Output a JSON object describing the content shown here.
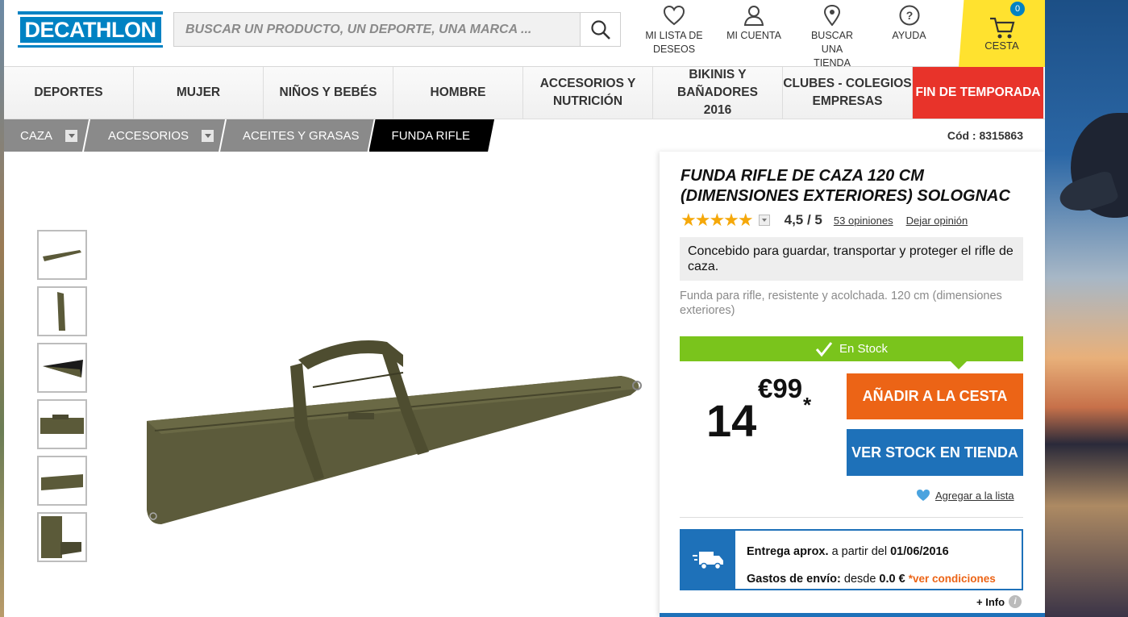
{
  "header": {
    "logo_text": "DECATHLON",
    "search_placeholder": "BUSCAR UN PRODUCTO, UN DEPORTE, UNA MARCA ...",
    "nav": [
      {
        "label_line1": "MI LISTA DE",
        "label_line2": "DESEOS",
        "icon": "heart-icon"
      },
      {
        "label_line1": "MI CUENTA",
        "label_line2": "",
        "icon": "user-icon"
      },
      {
        "label_line1": "BUSCAR UNA",
        "label_line2": "TIENDA",
        "icon": "map-pin-icon"
      },
      {
        "label_line1": "AYUDA",
        "label_line2": "",
        "icon": "help-icon"
      }
    ],
    "cart_label": "CESTA",
    "cart_count": "0"
  },
  "main_nav": [
    {
      "line1": "DEPORTES",
      "line2": ""
    },
    {
      "line1": "MUJER",
      "line2": ""
    },
    {
      "line1": "NIÑOS Y BEBÉS",
      "line2": ""
    },
    {
      "line1": "HOMBRE",
      "line2": ""
    },
    {
      "line1": "ACCESORIOS Y",
      "line2": "NUTRICIÓN"
    },
    {
      "line1": "BIKINIS Y BAÑADORES",
      "line2": "2016"
    },
    {
      "line1": "CLUBES - COLEGIOS",
      "line2": "EMPRESAS"
    },
    {
      "line1": "FIN DE TEMPORADA",
      "line2": ""
    }
  ],
  "breadcrumb": [
    "CAZA",
    "ACCESORIOS",
    "ACEITES Y GRASAS",
    "FUNDA RIFLE"
  ],
  "product_code": "Cód : 8315863",
  "product": {
    "title": "FUNDA RIFLE DE CAZA 120 CM (DIMENSIONES EXTERIORES) SOLOGNAC",
    "stars": "★★★★★",
    "rating": "4,5 / 5",
    "reviews_link": "53 opiniones",
    "leave_review": "Dejar opinión",
    "description": "Concebido para guardar, transportar y proteger el rifle de caza.",
    "description_small": "Funda para rifle, resistente y acolchada. 120 cm (dimensiones exteriores)",
    "stock_status": "En Stock",
    "price_int": "14",
    "price_dec": "€99",
    "price_note": "*",
    "add_to_cart": "AÑADIR A LA CESTA",
    "store_stock": "VER STOCK EN TIENDA",
    "wishlist_link": "Agregar a la lista"
  },
  "delivery": {
    "line1_label": "Entrega aprox.",
    "line1_text": "a partir del",
    "line1_date": "01/06/2016",
    "line2_label": "Gastos de envío:",
    "line2_text": "desde",
    "line2_price": "0.0 €",
    "line2_link": "*ver condiciones"
  },
  "info_link": "+ Info",
  "colors": {
    "brand_blue": "#0082c3",
    "cart_yellow": "#ffe22f",
    "sale_red": "#e8332a",
    "stock_green": "#7ac41c",
    "cta_orange": "#ec6416",
    "cta_blue": "#1e71b9"
  }
}
